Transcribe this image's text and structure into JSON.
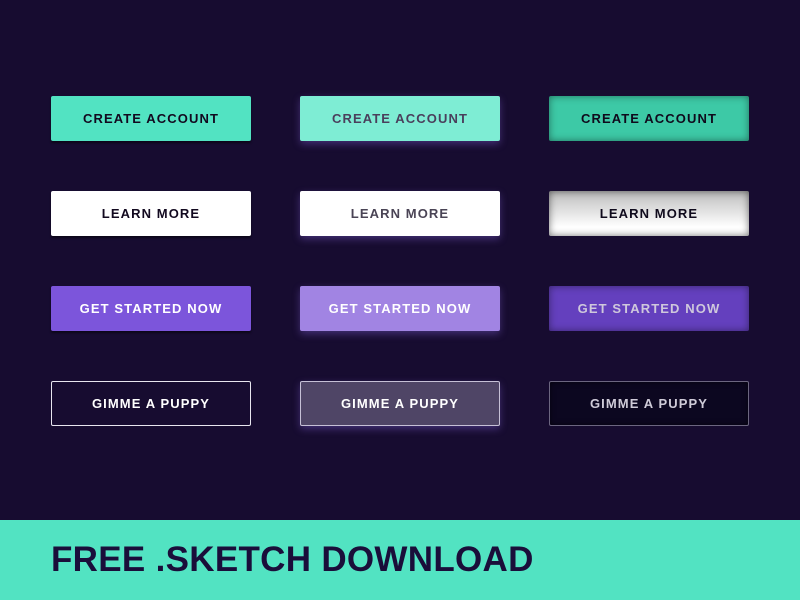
{
  "colors": {
    "background": "#170c30",
    "teal": "#52e3c2",
    "purple": "#7c55db",
    "white": "#ffffff",
    "banner": "#52e3c2",
    "banner_text": "#1a0e3a"
  },
  "states": [
    "default",
    "hover",
    "pressed"
  ],
  "rows": [
    {
      "style": "teal",
      "label": "CREATE ACCOUNT"
    },
    {
      "style": "white",
      "label": "LEARN MORE"
    },
    {
      "style": "purple",
      "label": "GET STARTED NOW"
    },
    {
      "style": "ghost",
      "label": "GIMME A PUPPY"
    }
  ],
  "banner": {
    "text": "FREE .SKETCH DOWNLOAD"
  }
}
